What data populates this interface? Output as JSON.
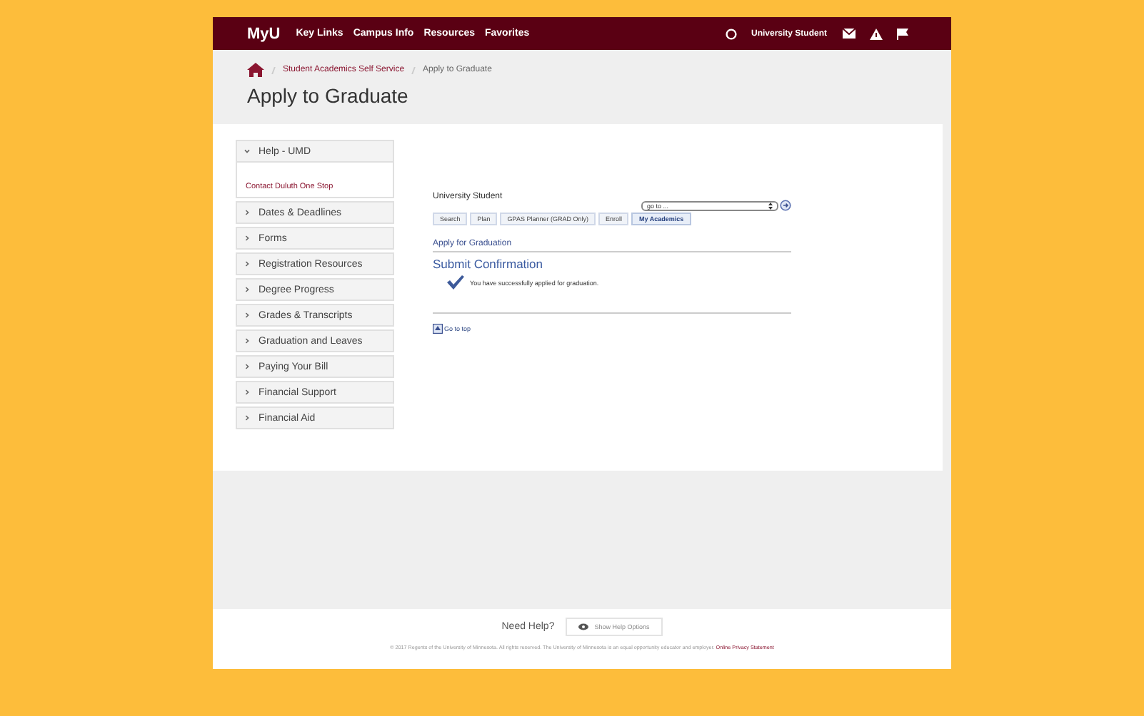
{
  "nav": {
    "logo": "MyU",
    "links": [
      "Key Links",
      "Campus Info",
      "Resources",
      "Favorites"
    ],
    "user": "University Student"
  },
  "breadcrumb": [
    "Student Academics Self Service",
    "Apply to Graduate"
  ],
  "title": "Apply to Graduate",
  "sidebar": [
    {
      "label": "Help - UMD",
      "expanded": true,
      "children": [
        "Contact Duluth One Stop"
      ]
    },
    {
      "label": "Dates & Deadlines",
      "expanded": false
    },
    {
      "label": "Forms",
      "expanded": false
    },
    {
      "label": "Registration Resources",
      "expanded": false
    },
    {
      "label": "Degree Progress",
      "expanded": false
    },
    {
      "label": "Grades & Transcripts",
      "expanded": false
    },
    {
      "label": "Graduation and Leaves",
      "expanded": false
    },
    {
      "label": "Paying Your Bill",
      "expanded": false
    },
    {
      "label": "Financial Support",
      "expanded": false
    },
    {
      "label": "Financial Aid",
      "expanded": false
    }
  ],
  "content": {
    "name": "University Student",
    "goto": "go to ...",
    "tabs": [
      {
        "label": "Search",
        "selected": false
      },
      {
        "label": "Plan",
        "selected": false
      },
      {
        "label": "GPAS Planner (GRAD Only)",
        "selected": false
      },
      {
        "label": "Enroll",
        "selected": false
      },
      {
        "label": "My Academics",
        "selected": true
      }
    ],
    "section": "Apply for Graduation",
    "heading": "Submit Confirmation",
    "message": "You have successfully applied for graduation.",
    "top_link": "Go to top"
  },
  "footer": {
    "help": "Need Help?",
    "help_button": "Show Help Options",
    "copyright": "© 2017 Regents of the University of Minnesota. All rights reserved. The University of Minnesota is an equal opportunity educator and employer.",
    "privacy": "Online Privacy Statement"
  }
}
